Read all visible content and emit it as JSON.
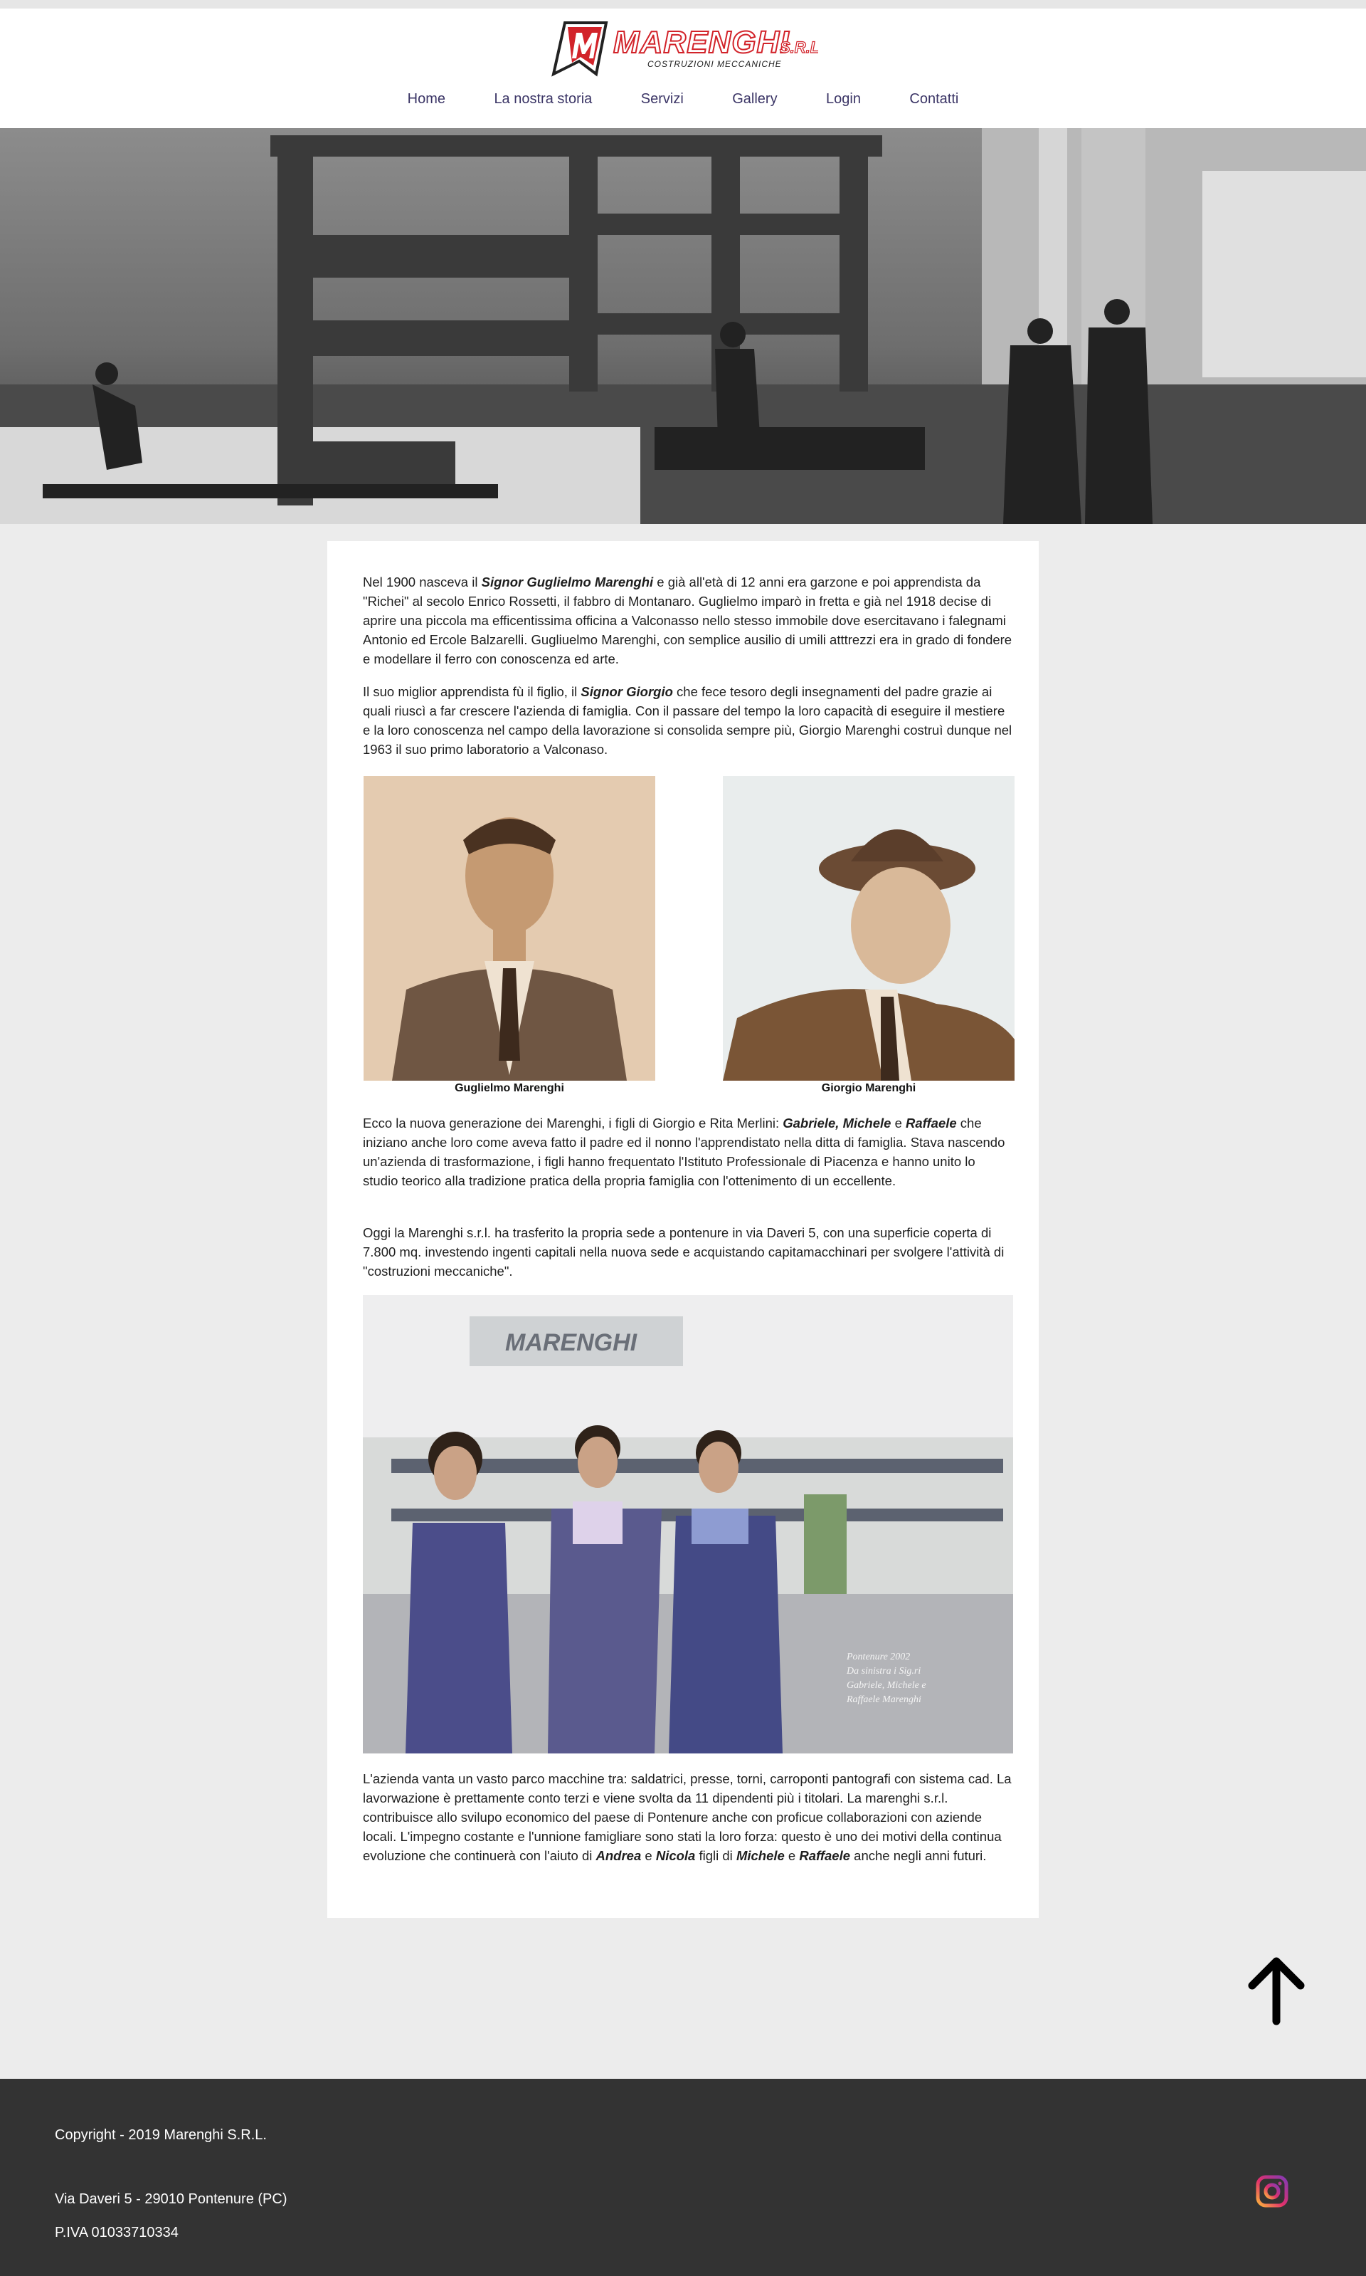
{
  "brand": {
    "name": "MARENGHI",
    "suffix": "S.R.L",
    "tagline": "COSTRUZIONI MECCANICHE",
    "accent": "#d2232a"
  },
  "nav": {
    "items": [
      {
        "label": "Home"
      },
      {
        "label": "La nostra storia"
      },
      {
        "label": "Servizi"
      },
      {
        "label": "Gallery"
      },
      {
        "label": "Login"
      },
      {
        "label": "Contatti"
      }
    ]
  },
  "story": {
    "p1": [
      "Nel 1900 nasceva il ",
      "Signor Guglielmo Marenghi",
      " e già all'età di 12 anni era garzone e poi apprendista da \"Richei\" al secolo Enrico Rossetti, il fabbro di Montanaro. Guglielmo imparò in fretta e già nel 1918 decise di aprire una piccola ma efficentissima officina a Valconasso nello stesso immobile dove esercitavano i falegnami Antonio ed Ercole Balzarelli. Gugliuelmo Marenghi, con semplice ausilio di umili atttrezzi era in grado di fondere e modellare il ferro con conoscenza ed arte."
    ],
    "p2": [
      "Il suo miglior apprendista fù il figlio, il ",
      "Signor Giorgio",
      " che fece tesoro degli insegnamenti del padre grazie ai quali riuscì a far crescere l'azienda di famiglia. Con il passare del tempo la loro capacità di eseguire il mestiere e la loro conoscenza nel campo della lavorazione si consolida sempre più, Giorgio Marenghi costruì dunque nel 1963 il suo primo laboratorio a Valconaso."
    ],
    "photo1_caption": "Guglielmo Marenghi",
    "photo2_caption": "Giorgio Marenghi",
    "p3": [
      "Ecco la nuova generazione dei Marenghi, i figli di Giorgio e Rita Merlini: ",
      "Gabriele, Michele",
      " e ",
      "Raffaele",
      " che iniziano anche loro come aveva fatto il padre ed il nonno l'apprendistato nella ditta di famiglia. Stava nascendo un'azienda di trasformazione, i figli hanno frequentato l'Istituto Professionale di Piacenza e hanno unito lo studio teorico alla tradizione pratica della propria famiglia con l'ottenimento di un eccellente."
    ],
    "p4": "Oggi la Marenghi s.r.l. ha trasferito la propria sede a pontenure in via Daveri 5, con una superficie coperta di 7.800 mq. investendo ingenti capitali nella nuova sede e acquistando capitamacchinari per svolgere l'attività di \"costruzioni meccaniche\".",
    "group_photo": {
      "sign": "MARENGHI",
      "note_lines": [
        "Pontenure 2002",
        "Da sinistra i Sig.ri",
        "Gabriele, Michele e",
        "Raffaele Marenghi"
      ]
    },
    "p5": [
      "L'azienda vanta un vasto parco macchine tra: saldatrici, presse, torni, carroponti pantografi con sistema cad. La lavorwazione è prettamente conto terzi e viene svolta da 11 dipendenti più i titolari. La marenghi s.r.l. contribuisce allo svilupo economico del paese di Pontenure anche con proficue collaborazioni con aziende locali. L'impegno costante e l'unnione famigliare sono stati la loro forza: questo è uno dei motivi della continua evoluzione che continuerà con l'aiuto di ",
      "Andrea",
      " e ",
      "Nicola",
      " figli di ",
      "Michele",
      " e ",
      "Raffaele",
      " anche negli anni futuri."
    ]
  },
  "footer": {
    "copyright": "Copyright - 2019 Marenghi S.R.L.",
    "address": "Via Daveri 5 - 29010 Pontenure (PC)",
    "vat": "P.IVA 01033710334",
    "social_icon": "instagram-icon"
  },
  "icons": {
    "back_to_top": "arrow-up-icon"
  }
}
